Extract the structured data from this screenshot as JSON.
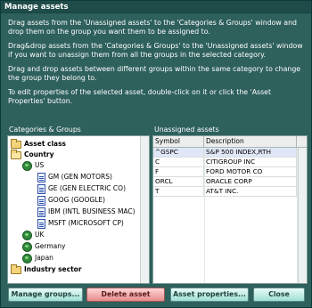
{
  "window": {
    "title": "Manage assets"
  },
  "instructions": [
    "Drag assets from the 'Unassigned assets' to the 'Categories & Groups' window and drop them on the group you want them to be assigned to.",
    "Drag&drop assets from the 'Categories & Groups' to the 'Unassigned assets' window if you want to unassign them from all the groups in the selected category.",
    "Drag and drop assets between different groups within the same category to change the group they belong to.",
    "To edit properties of the selected asset, double-click on it or click the 'Asset Properties' button."
  ],
  "categories_panel": {
    "label": "Categories & Groups",
    "tree": [
      {
        "label": "Asset class",
        "icon": "folder-icon",
        "bold": true
      },
      {
        "label": "Country",
        "icon": "folder-open-icon",
        "bold": true
      },
      {
        "label": "US",
        "icon": "globe-icon",
        "bold": false
      },
      {
        "label": "GM (GEN MOTORS)",
        "icon": "document-icon",
        "bold": false
      },
      {
        "label": "GE (GEN ELECTRIC CO)",
        "icon": "document-icon",
        "bold": false
      },
      {
        "label": "GOOG (GOOGLE)",
        "icon": "document-icon",
        "bold": false
      },
      {
        "label": "IBM (INTL BUSINESS MAC)",
        "icon": "document-icon",
        "bold": false
      },
      {
        "label": "MSFT (MICROSOFT CP)",
        "icon": "document-icon",
        "bold": false
      },
      {
        "label": "UK",
        "icon": "globe-icon",
        "bold": false
      },
      {
        "label": "Germany",
        "icon": "globe-icon",
        "bold": false
      },
      {
        "label": "Japan",
        "icon": "globe-icon",
        "bold": false
      },
      {
        "label": "Industry sector",
        "icon": "folder-icon",
        "bold": true
      }
    ]
  },
  "unassigned_panel": {
    "label": "Unassigned assets",
    "columns": [
      "Symbol",
      "Description"
    ],
    "rows": [
      {
        "symbol": "^GSPC",
        "description": "S&P 500 INDEX,RTH",
        "selected": true
      },
      {
        "symbol": "C",
        "description": "CITIGROUP INC",
        "selected": false
      },
      {
        "symbol": "F",
        "description": "FORD MOTOR CO",
        "selected": false
      },
      {
        "symbol": "ORCL",
        "description": "ORACLE CORP",
        "selected": false
      },
      {
        "symbol": "T",
        "description": "AT&T INC.",
        "selected": false
      }
    ]
  },
  "buttons": {
    "manage_groups": "Manage groups...",
    "delete_asset": "Delete asset",
    "asset_properties": "Asset properties...",
    "close": "Close"
  },
  "colors": {
    "window_bg": "#2e605c",
    "titlebar_bg": "#1f4c49",
    "button_gradient": "#9fe0d4",
    "delete_button": "#e58c8c"
  }
}
